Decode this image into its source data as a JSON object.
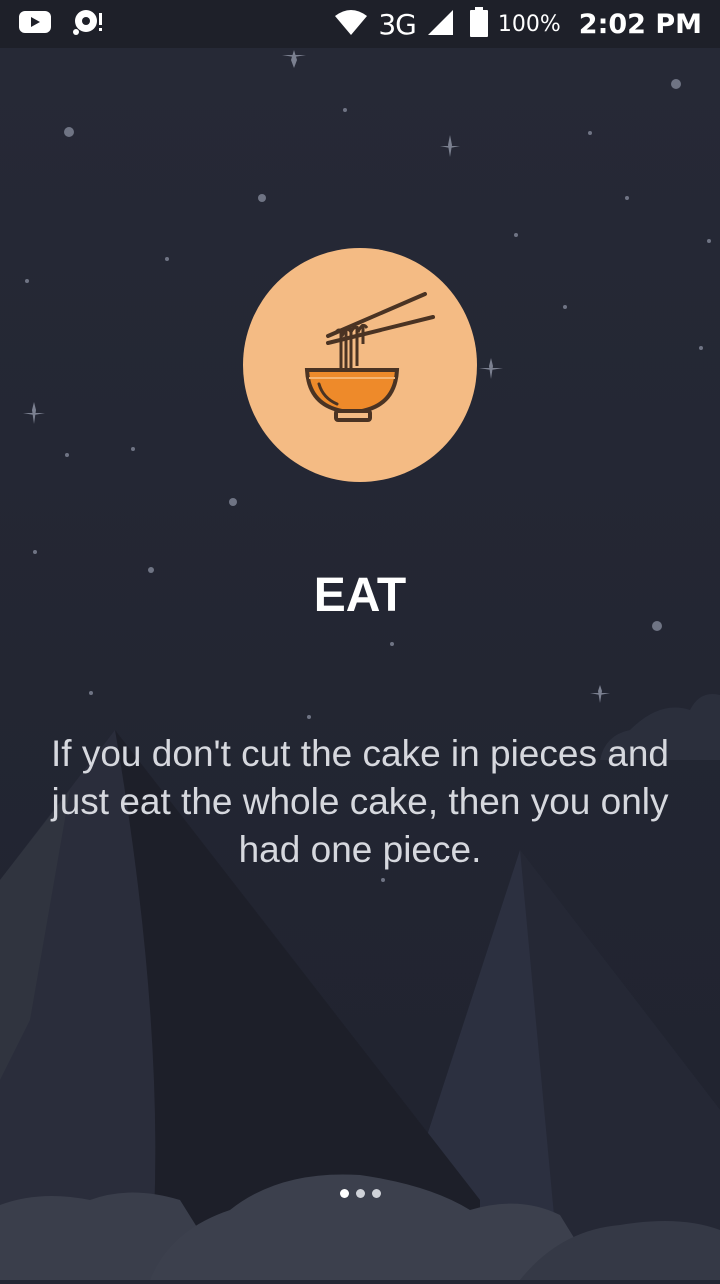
{
  "status_bar": {
    "left_icons": [
      "youtube-icon",
      "music-sync-icon"
    ],
    "right_icons": [
      "wifi-icon",
      "signal-icon",
      "battery-icon"
    ],
    "network": "3G",
    "battery": "100%",
    "time": "2:02 PM"
  },
  "onboarding": {
    "icon": "noodle-bowl-icon",
    "title": "EAT",
    "description": "If you don't cut the cake in pieces and just eat the whole cake, then you only had one piece.",
    "page_indicator": {
      "total": 3,
      "current": 1
    }
  },
  "colors": {
    "background": "#232633",
    "mountain_dark": "#1b1d27",
    "mountain_light": "#2d3140",
    "cloud": "#3a3e4d",
    "icon_circle": "#f4bb84",
    "bowl_fill": "#ee8a2a",
    "icon_stroke": "#4a3323",
    "title_color": "#ffffff",
    "text_color": "#d6d8de"
  }
}
